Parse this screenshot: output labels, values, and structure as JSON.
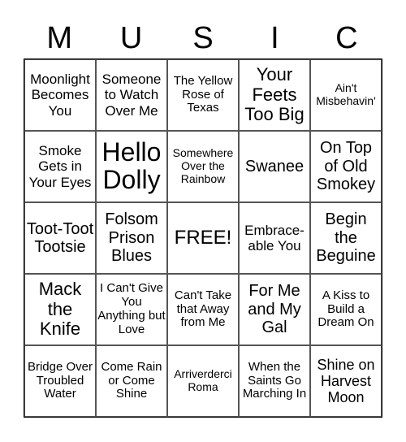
{
  "header": {
    "letters": [
      "M",
      "U",
      "S",
      "I",
      "C"
    ]
  },
  "grid": {
    "rows": [
      [
        "Moonlight Becomes You",
        "Someone to Watch Over Me",
        "The Yellow Rose of Texas",
        "Your Feets Too Big",
        "Ain't Misbehavin'"
      ],
      [
        "Smoke Gets in Your Eyes",
        "Hello Dolly",
        "Somewhere Over the Rainbow",
        "Swanee",
        "On Top of Old Smokey"
      ],
      [
        "Toot-Toot Tootsie",
        "Folsom Prison Blues",
        "FREE!",
        "Embrace-able You",
        "Begin the Beguine"
      ],
      [
        "Mack the Knife",
        "I Can't Give You Anything but Love",
        "Can't Take that Away from Me",
        "For Me and My Gal",
        "A Kiss to Build a Dream On"
      ],
      [
        "Bridge Over Troubled Water",
        "Come Rain or Come Shine",
        "Arriverderci Roma",
        "When the Saints Go Marching In",
        "Shine on Harvest Moon"
      ]
    ]
  }
}
